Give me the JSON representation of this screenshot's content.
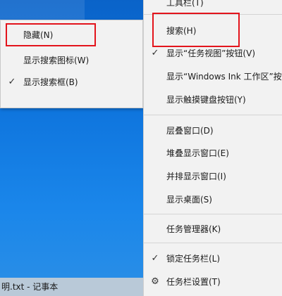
{
  "colors": {
    "desktop": "#0e74dd",
    "menu_bg": "#f2f2f2",
    "highlight": "#e3141c"
  },
  "submenu": {
    "items": [
      {
        "label": "隐藏(N)",
        "checked": false
      },
      {
        "label": "显示搜索图标(W)",
        "checked": false
      },
      {
        "label": "显示搜索框(B)",
        "checked": true
      }
    ]
  },
  "context_menu": {
    "items": [
      {
        "label": "工具栏(T)"
      },
      {
        "label": "搜索(H)"
      },
      {
        "label": "显示“任务视图”按钮(V)"
      },
      {
        "label": "显示“Windows Ink 工作区”按钮"
      },
      {
        "label": "显示触摸键盘按钮(Y)"
      },
      {
        "label": "层叠窗口(D)"
      },
      {
        "label": "堆叠显示窗口(E)"
      },
      {
        "label": "并排显示窗口(I)"
      },
      {
        "label": "显示桌面(S)"
      },
      {
        "label": "任务管理器(K)"
      },
      {
        "label": "锁定任务栏(L)"
      },
      {
        "label": "任务栏设置(T)"
      }
    ],
    "check_glyph": "✓",
    "settings_icon_glyph": "⚙"
  },
  "taskbar": {
    "window_title": "明.txt - 记事本"
  }
}
